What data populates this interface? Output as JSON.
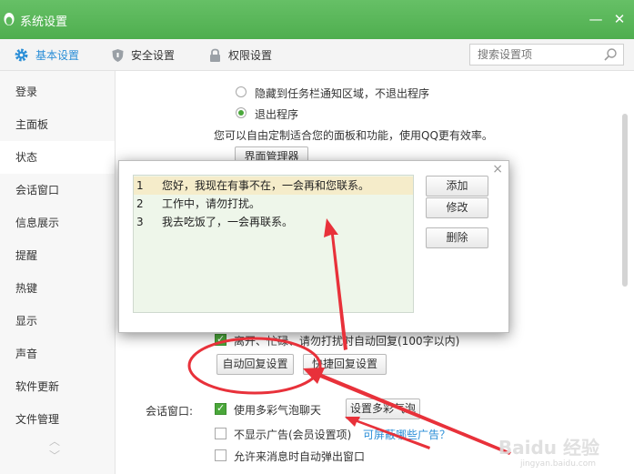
{
  "window": {
    "title": "系统设置",
    "min_symbol": "—",
    "close_symbol": "✕"
  },
  "tabs": [
    {
      "label": "基本设置",
      "icon": "gear-icon",
      "active": true
    },
    {
      "label": "安全设置",
      "icon": "shield-icon"
    },
    {
      "label": "权限设置",
      "icon": "lock-icon"
    }
  ],
  "search": {
    "placeholder": "搜索设置项"
  },
  "sidebar": {
    "items": [
      {
        "label": "登录"
      },
      {
        "label": "主面板"
      },
      {
        "label": "状态",
        "active": true
      },
      {
        "label": "会话窗口"
      },
      {
        "label": "信息展示"
      },
      {
        "label": "提醒"
      },
      {
        "label": "热键"
      },
      {
        "label": "显示"
      },
      {
        "label": "声音"
      },
      {
        "label": "软件更新"
      },
      {
        "label": "文件管理"
      }
    ],
    "scroll_up": "︿",
    "scroll_down": "﹀"
  },
  "main": {
    "radio_hide": "隐藏到任务栏通知区域，不退出程序",
    "radio_exit": "退出程序",
    "panel_desc": "您可以自由定制适合您的面板和功能，使用QQ更有效率。",
    "panel_manager_btn": "界面管理器",
    "auto_reply_check": "离开、忙碌、请勿打扰时自动回复(100字以内)",
    "auto_reply_settings_btn": "自动回复设置",
    "quick_reply_btn": "快捷回复设置",
    "session_label": "会话窗口:",
    "bubble_check": "使用多彩气泡聊天",
    "bubble_btn": "设置多彩气泡",
    "no_ads_check": "不显示广告(会员设置项)",
    "no_ads_link": "可屏蔽哪些广告？",
    "popup_check": "允许来消息时自动弹出窗口"
  },
  "popup": {
    "close_symbol": "×",
    "messages": [
      {
        "num": "1",
        "text": "您好，我现在有事不在，一会再和您联系。",
        "selected": true
      },
      {
        "num": "2",
        "text": "工作中，请勿打扰。"
      },
      {
        "num": "3",
        "text": "我去吃饭了，一会再联系。"
      }
    ],
    "buttons": {
      "add": "添加",
      "edit": "修改",
      "delete": "删除"
    }
  },
  "watermark": {
    "text": "Baidu 经验",
    "sub": "jingyan.baidu.com"
  },
  "colors": {
    "title_green": "#5cb85c",
    "accent_blue": "#2a8ed7",
    "annotation_red": "#e8313a",
    "check_green": "#4aa73a"
  }
}
